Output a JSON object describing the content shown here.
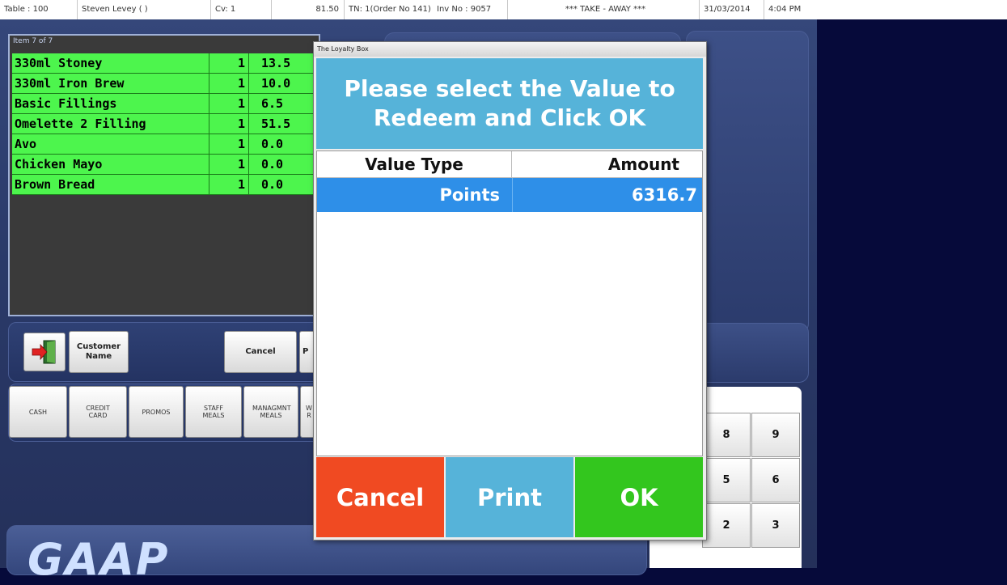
{
  "status_bar": {
    "table": "Table : 100",
    "customer": "Steven Levey (  )",
    "cv": "Cv: 1",
    "total": "81.50",
    "tn": "TN: 1(Order No 141)",
    "inv": "Inv No : 9057",
    "mode": "*** TAKE - AWAY ***",
    "date": "31/03/2014",
    "time": "4:04 PM"
  },
  "order": {
    "item_count": "Item 7 of 7",
    "items": [
      {
        "name": "330ml Stoney",
        "qty": "1",
        "price": "13.5"
      },
      {
        "name": "330ml Iron Brew",
        "qty": "1",
        "price": "10.0"
      },
      {
        "name": "Basic Fillings",
        "qty": "1",
        "price": "6.5"
      },
      {
        "name": "Omelette 2 Filling",
        "qty": "1",
        "price": "51.5"
      },
      {
        "name": "Avo",
        "qty": "1",
        "price": "0.0"
      },
      {
        "name": "Chicken Mayo",
        "qty": "1",
        "price": "0.0"
      },
      {
        "name": "Brown Bread",
        "qty": "1",
        "price": "0.0"
      }
    ]
  },
  "action_bar": {
    "customer_name": "Customer Name",
    "cancel": "Cancel",
    "partial": "P"
  },
  "payment_bar": {
    "cash": "CASH",
    "credit_card": "CREDIT CARD",
    "promos": "PROMOS",
    "staff_meals": "STAFF MEALS",
    "management_meals": "MANAGMNT MEALS",
    "partial": "W R"
  },
  "numpad": {
    "keys": [
      "8",
      "9",
      "5",
      "6",
      "2",
      "3"
    ]
  },
  "logo_text": "GAAP",
  "dialog": {
    "window_title": "The Loyalty Box",
    "header_line1": "Please select the Value to",
    "header_line2": "Redeem and Click OK",
    "col_value_type": "Value Type",
    "col_amount": "Amount",
    "rows": [
      {
        "value_type": "Points",
        "amount": "6316.7"
      }
    ],
    "cancel_label": "Cancel",
    "print_label": "Print",
    "ok_label": "OK",
    "colors": {
      "header": "#56b3d9",
      "selected_row": "#2e8fe8",
      "cancel": "#f04a22",
      "print": "#56b3d9",
      "ok": "#33c61e"
    }
  },
  "colors": {
    "order_row": "#4df54d",
    "background_right": "#060a3a"
  }
}
